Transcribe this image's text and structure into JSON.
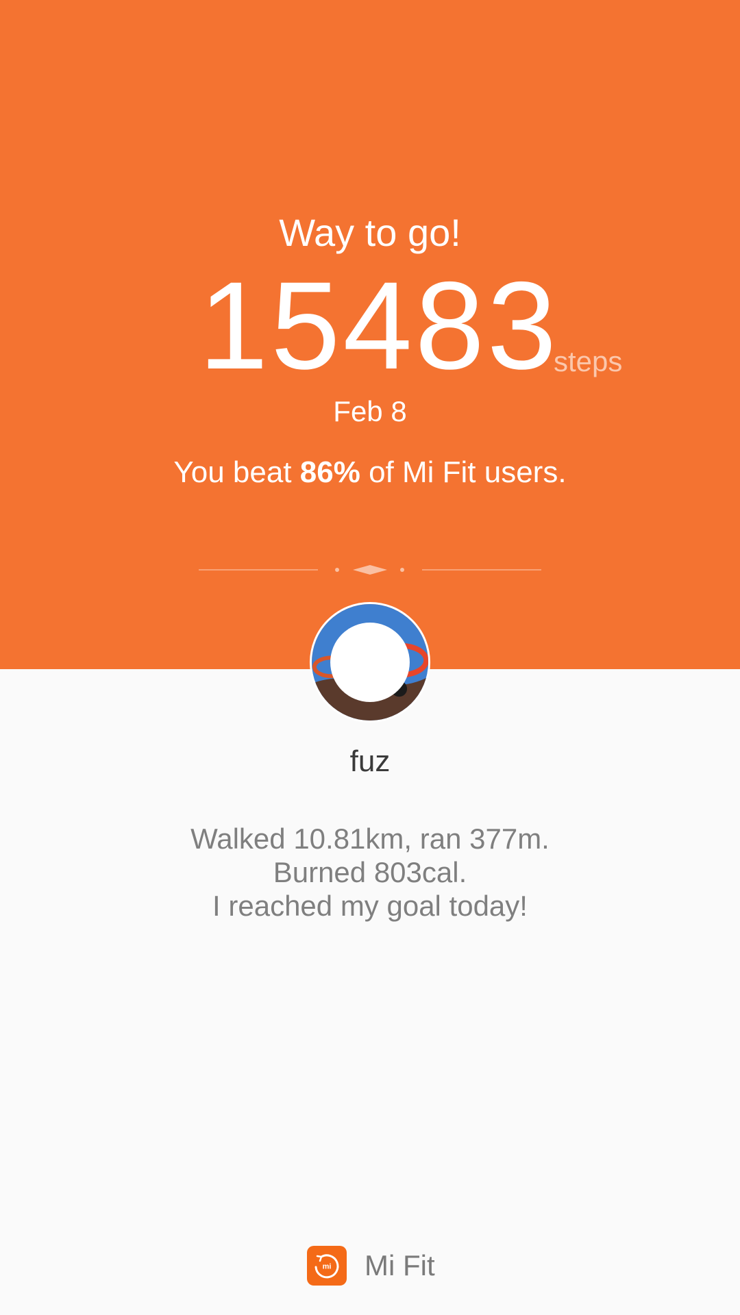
{
  "share_card": {
    "headline": "Way to go!",
    "steps_value": "15483",
    "steps_unit": "steps",
    "date": "Feb 8",
    "beat_prefix": "You beat ",
    "beat_percent": "86%",
    "beat_suffix": " of Mi Fit users.",
    "accent_color": "#f47331"
  },
  "user": {
    "name": "fuz"
  },
  "summary": {
    "line1": "Walked 10.81km, ran 377m.",
    "line2": "Burned 803cal.",
    "line3": "I reached my goal today!"
  },
  "brand": {
    "logo_text": "mi",
    "name": "Mi Fit"
  },
  "icons": {
    "divider": "ornament-divider-icon",
    "avatar": "avatar-photo",
    "logo": "mi-fit-logo-icon"
  }
}
